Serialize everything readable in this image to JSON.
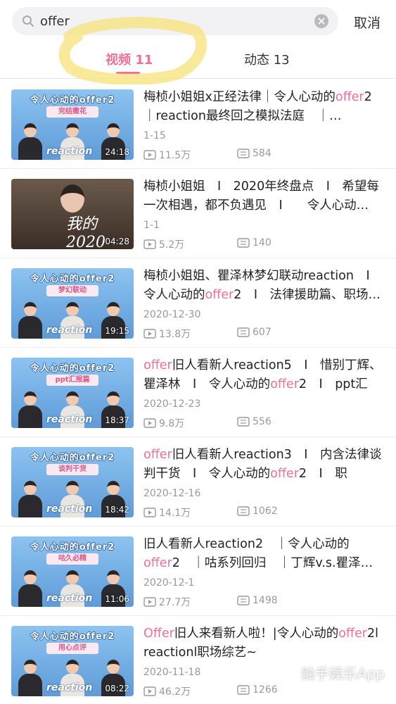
{
  "search": {
    "query": "offer",
    "cancel_label": "取消"
  },
  "tabs": [
    {
      "label": "视频 11",
      "active": true
    },
    {
      "label": "动态 13",
      "active": false
    }
  ],
  "colors": {
    "accent": "#f36f97",
    "meta": "#999999",
    "highlight_scribble": "#f6e27a"
  },
  "videos": [
    {
      "title_parts": [
        "梅桢小姐姐x正经法律｜令人心动的",
        "offer",
        "2｜reaction最终回之模拟法庭　｜…"
      ],
      "date": "1-15",
      "plays": "11.5万",
      "comments": "584",
      "duration": "24:18",
      "thumb": {
        "style": "blue",
        "title": "令人心动的offer2",
        "sub": "完结撒花",
        "tag": "reaction"
      }
    },
    {
      "title_parts": [
        "梅桢小姐姐　I　2020年终盘点　I　希望每一次相遇，都不负遇见　I　　令人心动…"
      ],
      "date": "1-1",
      "plays": "5.2万",
      "comments": "140",
      "duration": "04:28",
      "thumb": {
        "style": "brown",
        "title": "",
        "sub": "",
        "tag": "",
        "year": "我的2020"
      }
    },
    {
      "title_parts": [
        "梅桢小姐姐、瞿泽林梦幻联动reaction　I　令人心动的",
        "offer",
        "2　I　法律援助篇、职场…"
      ],
      "date": "2020-12-30",
      "plays": "13.8万",
      "comments": "607",
      "duration": "19:15",
      "thumb": {
        "style": "blue",
        "title": "令人心动的offer2",
        "sub": "梦幻联动",
        "tag": "reaction"
      }
    },
    {
      "title_parts": [
        "offer",
        "旧人看新人reaction5　I　惜别丁辉、瞿泽林　I　令人心动的",
        "offer",
        "2　I　ppt汇报…"
      ],
      "date": "2020-12-23",
      "plays": "9.8万",
      "comments": "556",
      "duration": "18:37",
      "thumb": {
        "style": "blue",
        "title": "令人心动的offer2",
        "sub": "ppt汇报篇",
        "tag": "reaction"
      }
    },
    {
      "title_parts": [
        "offer",
        "旧人看新人reaction3　I　内含法律谈判干货　I　令人心动的",
        "offer",
        "2　I　职场、…"
      ],
      "date": "2020-12-16",
      "plays": "14.1万",
      "comments": "1062",
      "duration": "18:42",
      "thumb": {
        "style": "blue",
        "title": "令人心动的offer2",
        "sub": "谈判干货",
        "tag": "reaction"
      }
    },
    {
      "title_parts": [
        "旧人看新人reaction2　｜令人心动的",
        "offer",
        "2　｜咕系列回归　｜丁辉v.s.瞿泽…"
      ],
      "date": "2020-12-1",
      "plays": "27.7万",
      "comments": "1498",
      "duration": "11:06",
      "thumb": {
        "style": "blue",
        "title": "令人心动的offer2",
        "sub": "咕久必精",
        "tag": "reaction"
      }
    },
    {
      "title_parts": [
        "Offer",
        "旧人来看新人啦！|令人心动的",
        "offer",
        "2l　reactionl职场综艺~"
      ],
      "date": "2020-11-18",
      "plays": "46.2万",
      "comments": "1266",
      "duration": "08:22",
      "thumb": {
        "style": "blue",
        "title": "令人心动的offer2",
        "sub": "用心点评",
        "tag": "reaction"
      }
    }
  ],
  "watermark": "触手娱乐App"
}
